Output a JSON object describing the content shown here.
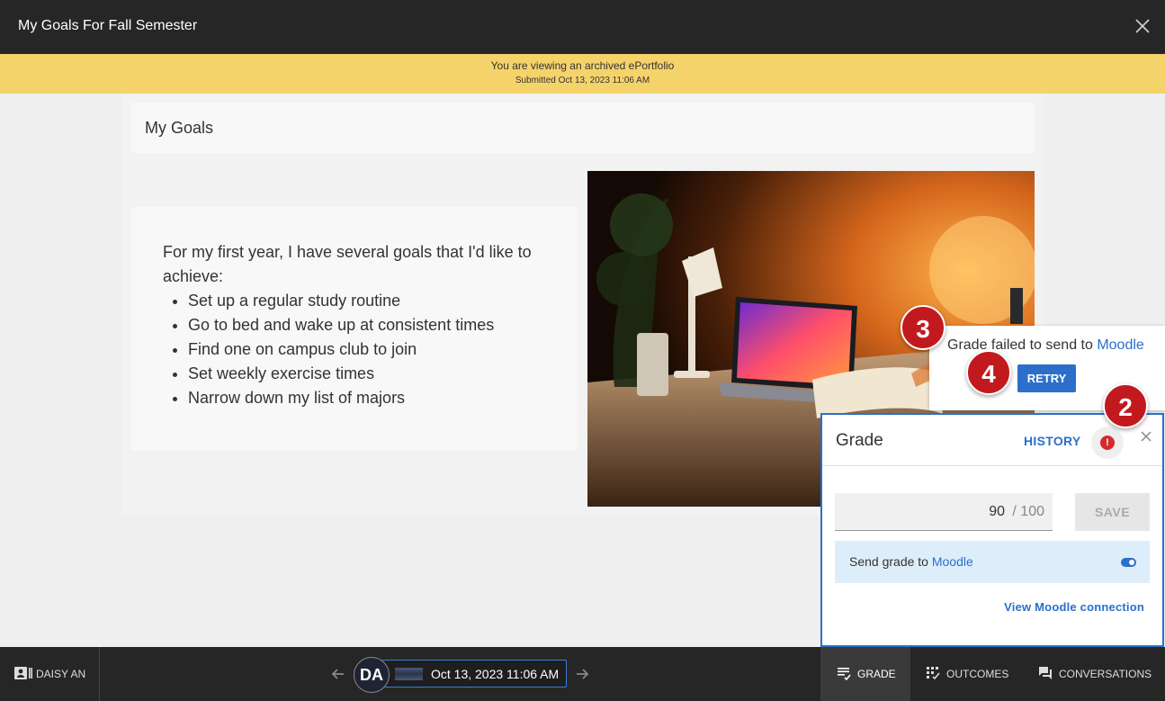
{
  "header": {
    "title": "My Goals For Fall Semester",
    "close_icon": "close-icon"
  },
  "banner": {
    "line1": "You are viewing an archived ePortfolio",
    "line2": "Submitted Oct 13, 2023 11:06 AM"
  },
  "page": {
    "heading": "My Goals",
    "intro": "For my first year, I have several goals that I'd like to achieve:",
    "goals": [
      "Set up a regular study routine",
      "Go to bed and wake up at consistent times",
      "Find one on campus club to join",
      "Set weekly exercise times",
      "Narrow down my list of majors"
    ]
  },
  "fail_popup": {
    "message": "Grade failed to send to ",
    "link": "Moodle",
    "retry_label": "RETRY"
  },
  "callouts": {
    "c2": "2",
    "c3": "3",
    "c4": "4"
  },
  "grade_panel": {
    "title": "Grade",
    "history_label": "HISTORY",
    "warning_glyph": "!",
    "score": "90",
    "max": "/ 100",
    "save_label": "SAVE",
    "send_label": "Send grade to ",
    "send_link": "Moodle",
    "send_enabled": true,
    "view_connection": "View Moodle connection"
  },
  "bottom_bar": {
    "student_name": "DAISY AN",
    "avatar_initials": "DA",
    "submission_date": "Oct 13, 2023 11:06 AM",
    "tabs": [
      {
        "label": "GRADE",
        "icon": "grade-icon",
        "active": true
      },
      {
        "label": "OUTCOMES",
        "icon": "outcomes-icon",
        "active": false
      },
      {
        "label": "CONVERSATIONS",
        "icon": "conversations-icon",
        "active": false
      }
    ]
  },
  "colors": {
    "accent": "#2b6fcb",
    "banner": "#f5d36b",
    "callout": "#c2191f",
    "bar": "#262626"
  }
}
